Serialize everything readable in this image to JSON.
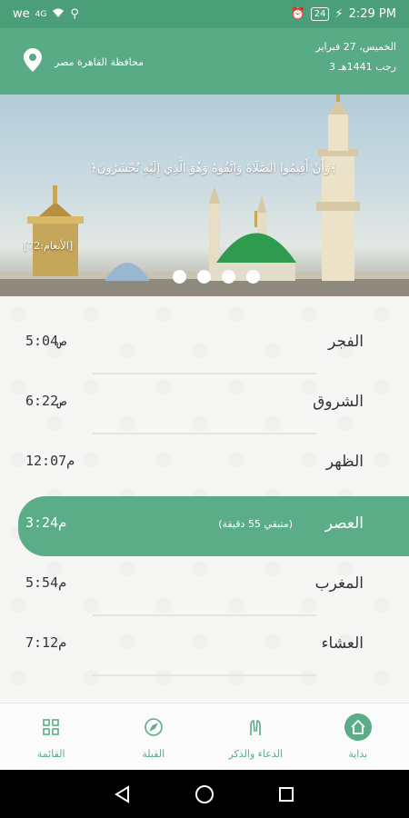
{
  "status_bar": {
    "carrier": "we",
    "network": "4G",
    "battery": "24",
    "time": "2:29 PM"
  },
  "header": {
    "location": "محافظة القاهرة مصر",
    "gregorian_date": "الخميس، 27 فبراير",
    "hijri_date": "3 رجب 1441هـ"
  },
  "banner": {
    "verse": "﴿وَأَنْ أَقِيمُوا الصَّلَاةَ وَاتَّقُوهُ وَهُوَ الَّذِي إِلَيْهِ تُحْشَرُونَ﴾",
    "verse_ref": "[الأنعام:72]",
    "slide_count": 4
  },
  "prayers": [
    {
      "name": "الفجر",
      "time": "5:04ص"
    },
    {
      "name": "الشروق",
      "time": "6:22ص"
    },
    {
      "name": "الظهر",
      "time": "12:07م"
    },
    {
      "name": "العصر",
      "time": "3:24م",
      "remaining": "(متبقي 55 دقيقة)",
      "active": true
    },
    {
      "name": "المغرب",
      "time": "5:54م"
    },
    {
      "name": "العشاء",
      "time": "7:12م"
    }
  ],
  "bottom_nav": [
    {
      "label": "القائمة",
      "icon": "grid-icon"
    },
    {
      "label": "القبلة",
      "icon": "compass-icon"
    },
    {
      "label": "الدعاء والذكر",
      "icon": "praying-hands-icon"
    },
    {
      "label": "بداية",
      "icon": "home-icon",
      "active": true
    }
  ],
  "colors": {
    "primary": "#5aad87",
    "status_bar": "#4a9f78"
  }
}
